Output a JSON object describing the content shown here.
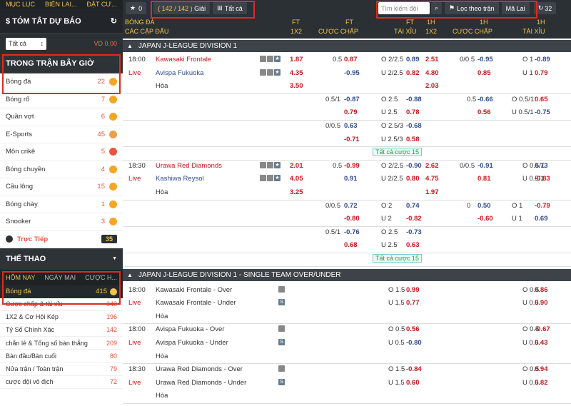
{
  "sidebar": {
    "top_tabs": [
      "MỤC LỤC",
      "BIÊN LAI...",
      "ĐẶT CƯ..."
    ],
    "summary_title": "$ TÓM TẮT DỰ BÁO",
    "filter_value": "Tất cả",
    "vd": "VD 0.00",
    "live_title": "TRONG TRẬN BÂY GIỜ",
    "live_sports": [
      {
        "name": "Bóng đá",
        "count": "22"
      },
      {
        "name": "Bóng rổ",
        "count": "7"
      },
      {
        "name": "Quần vợt",
        "count": "6"
      },
      {
        "name": "E-Sports",
        "count": "45"
      },
      {
        "name": "Môn crikê",
        "count": "5"
      },
      {
        "name": "Bóng chuyền",
        "count": "4"
      },
      {
        "name": "Cầu lông",
        "count": "15"
      },
      {
        "name": "Bóng chày",
        "count": "1"
      },
      {
        "name": "Snooker",
        "count": "3"
      }
    ],
    "direct_label": "Trực Tiếp",
    "direct_count": "35",
    "sport_title": "THỂ THAO",
    "day_tabs": [
      "HÔM NAY",
      "NGÀY MAI",
      "CƯỢC H..."
    ],
    "football": {
      "name": "Bóng đá",
      "count": "415"
    },
    "bet_types": [
      {
        "name": "Cược chấp & tài xỉu",
        "count": "343"
      },
      {
        "name": "1X2 & Cơ Hội Kép",
        "count": "196"
      },
      {
        "name": "Tỷ Số Chính Xác",
        "count": "142"
      },
      {
        "name": "chẵn lẻ & Tổng số bàn thắng",
        "count": "209"
      },
      {
        "name": "Bàn đầu/Bàn cuối",
        "count": "80"
      },
      {
        "name": "Nửa trận / Toàn trận",
        "count": "79"
      },
      {
        "name": "cược đội vô địch",
        "count": "72"
      }
    ]
  },
  "toolbar": {
    "star_count": "0",
    "league_count": "( 142 / 142 )",
    "league_label": "Giải",
    "all_label": "Tất cả",
    "search_placeholder": "Tìm kiếm đội",
    "filter_label": "Lọc theo trận",
    "odds_type": "Mã Lai",
    "refresh_count": "32"
  },
  "columns": {
    "sport": "BÓNG ĐÁ",
    "match": "CÁC CẶP ĐẤU",
    "ft": "FT",
    "x12": "1X2",
    "ft_hdp": "FT",
    "hdp": "CƯỢC CHẤP",
    "ft_ou": "FT",
    "ou": "TÀI XỈU",
    "h1": "1H",
    "h1x12": "1X2",
    "h1_hdp": "1H",
    "h1hdp": "CƯỢC CHẤP",
    "h1_ou": "1H",
    "h1ou": "TÀI XỈU"
  },
  "leagues": [
    {
      "name": "JAPAN J-LEAGUE DIVISION 1"
    },
    {
      "name": "JAPAN J-LEAGUE DIVISION 1 - SINGLE TEAM OVER/UNDER"
    }
  ],
  "matches": [
    {
      "time": "18:00",
      "live": "Live",
      "home": "Kawasaki Frontale",
      "away": "Avispa Fukuoka",
      "draw": "Hòa",
      "x12": [
        "1.87",
        "4.35",
        "3.50"
      ],
      "hdp_line": "0.5",
      "hdp": [
        "0.87",
        "-0.95"
      ],
      "ou_lines": [
        "O 2/2.5",
        "U 2/2.5"
      ],
      "ou": [
        "0.89",
        "0.82"
      ],
      "h1x12": [
        "2.51",
        "4.80",
        "2.03"
      ],
      "h1hdp_line": "0/0.5",
      "h1hdp": [
        "-0.95",
        "0.85"
      ],
      "h1ou_lines": [
        "O 1",
        "U 1"
      ],
      "h1ou": [
        "-0.89",
        "0.79"
      ],
      "extra": [
        {
          "hdp_line": "0.5/1",
          "hdp": [
            "-0.87",
            "0.79"
          ],
          "ou_lines": [
            "O 2.5",
            "U 2.5"
          ],
          "ou": [
            "-0.88",
            "0.78"
          ],
          "h1hdp_line": "0.5",
          "h1hdp": [
            "-0.66",
            "0.56"
          ],
          "h1ou_lines": [
            "O 0.5/1",
            "U 0.5/1"
          ],
          "h1ou": [
            "0.65",
            "-0.75"
          ]
        },
        {
          "hdp_line": "0/0.5",
          "hdp": [
            "0.63",
            "-0.71"
          ],
          "ou_lines": [
            "O 2.5/3",
            "U 2.5/3"
          ],
          "ou": [
            "-0.68",
            "0.58"
          ]
        }
      ],
      "all_bets": "Tất cả cược 15"
    },
    {
      "time": "18:30",
      "live": "Live",
      "home": "Urawa Red Diamonds",
      "away": "Kashiwa Reysol",
      "draw": "Hòa",
      "x12": [
        "2.01",
        "4.05",
        "3.25"
      ],
      "hdp_line": "0.5",
      "hdp": [
        "-0.99",
        "0.91"
      ],
      "ou_lines": [
        "O 2/2.5",
        "U 2/2.5"
      ],
      "ou": [
        "-0.90",
        "0.80"
      ],
      "h1x12": [
        "2.62",
        "4.75",
        "1.97"
      ],
      "h1hdp_line": "0/0.5",
      "h1hdp": [
        "-0.91",
        "0.81"
      ],
      "h1ou_lines": [
        "O 0.5/1",
        "U 0.5/1"
      ],
      "h1ou": [
        "0.73",
        "-0.83"
      ],
      "extra": [
        {
          "hdp_line": "0/0.5",
          "hdp": [
            "0.72",
            "-0.80"
          ],
          "ou_lines": [
            "O 2",
            "U 2"
          ],
          "ou": [
            "0.74",
            "-0.82"
          ],
          "h1hdp_line": "0",
          "h1hdp": [
            "0.50",
            "-0.60"
          ],
          "h1ou_lines": [
            "O 1",
            "U 1"
          ],
          "h1ou": [
            "-0.79",
            "0.69"
          ]
        },
        {
          "hdp_line": "0.5/1",
          "hdp": [
            "-0.76",
            "0.68"
          ],
          "ou_lines": [
            "O 2.5",
            "U 2.5"
          ],
          "ou": [
            "-0.73",
            "0.63"
          ]
        }
      ],
      "all_bets": "Tất cả cược 15"
    }
  ],
  "single_team": [
    {
      "time": "18:00",
      "live": "Live",
      "over": "Kawasaki Frontale - Over",
      "under": "Kawasaki Frontale - Under",
      "draw": "Hòa",
      "ou_lines": [
        "O 1.5",
        "U 1.5"
      ],
      "ou": [
        "0.99",
        "0.77"
      ],
      "h1ou_lines": [
        "O 0.5",
        "U 0.5"
      ],
      "h1ou": [
        "0.86",
        "0.90"
      ]
    },
    {
      "time": "18:00",
      "live": "Live",
      "over": "Avispa Fukuoka - Over",
      "under": "Avispa Fukuoka - Under",
      "draw": "Hòa",
      "ou_lines": [
        "O 0.5",
        "U 0.5"
      ],
      "ou": [
        "0.56",
        "-0.80"
      ],
      "h1ou_lines": [
        "O 0.5",
        "U 0.5"
      ],
      "h1ou": [
        "-0.67",
        "0.43"
      ]
    },
    {
      "time": "18:30",
      "live": "Live",
      "over": "Urawa Red Diamonds - Over",
      "under": "Urawa Red Diamonds - Under",
      "draw": "Hòa",
      "ou_lines": [
        "O 1.5",
        "U 1.5"
      ],
      "ou": [
        "-0.84",
        "0.60"
      ],
      "h1ou_lines": [
        "O 0.5",
        "U 0.5"
      ],
      "h1ou": [
        "0.94",
        "0.82"
      ]
    }
  ]
}
